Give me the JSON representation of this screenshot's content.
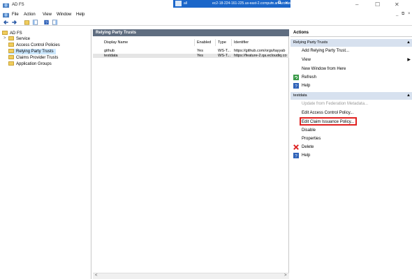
{
  "window": {
    "title": "AD FS",
    "rdp": {
      "signal": "all",
      "host": "ec2-18-224-161-225.us-east-2.compute.amazonaws.com"
    }
  },
  "menu": {
    "items": [
      "File",
      "Action",
      "View",
      "Window",
      "Help"
    ]
  },
  "tree": {
    "root": "AD FS",
    "items": [
      {
        "label": "Service"
      },
      {
        "label": "Access Control Policies"
      },
      {
        "label": "Relying Party Trusts"
      },
      {
        "label": "Claims Provider Trusts"
      },
      {
        "label": "Application Groups"
      }
    ]
  },
  "center": {
    "title": "Relying Party Trusts",
    "columns": [
      "Display Name",
      "Enabled",
      "Type",
      "Identifier"
    ],
    "rows": [
      {
        "name": "github",
        "enabled": "Yes",
        "type": "WS-T...",
        "identifier": "https://github.com/orgs/tayyab"
      },
      {
        "name": "testdata",
        "enabled": "Yes",
        "type": "WS-T...",
        "identifier": "https://feature-2.qa.ecloudiq.co"
      }
    ]
  },
  "actions": {
    "title": "Actions",
    "section1": {
      "label": "Relying Party Trusts",
      "items": [
        "Add Relying Party Trust...",
        "View",
        "New Window from Here",
        "Refresh",
        "Help"
      ]
    },
    "section2": {
      "label": "testdata",
      "items": [
        "Update from Federation Metadata...",
        "Edit Access Control Policy...",
        "Edit Claim Issuance Policy...",
        "Disable",
        "Properties",
        "Delete",
        "Help"
      ]
    }
  },
  "colors": {
    "header": "#5f6d80",
    "section": "#d7e1ef",
    "highlight": "#e0201f",
    "rdp": "#1b66c9"
  }
}
